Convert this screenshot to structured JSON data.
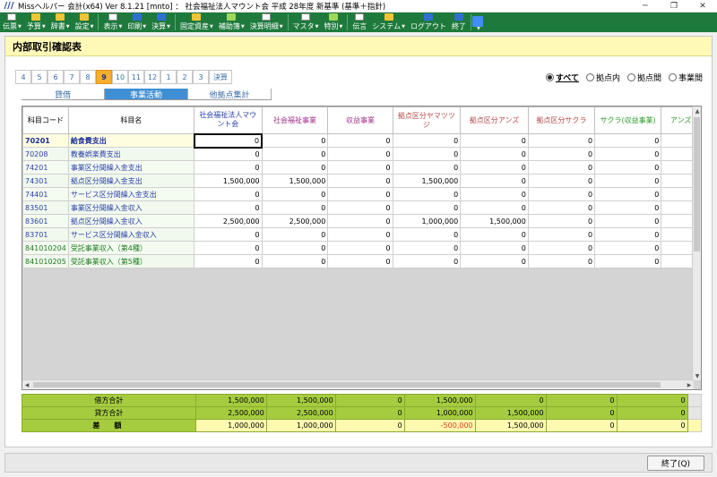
{
  "window": {
    "title": "Missヘルパー 会計(x64)   Ver 8.1.21 [mnto]  ：  社会福祉法人マウント会 平成 28年度 新基準 (基準＋指針)",
    "controls": [
      "─",
      "❐",
      "✕"
    ]
  },
  "toolbar": [
    {
      "label": "伝票",
      "icon": "slip-icon",
      "has_arrow": true
    },
    {
      "label": "予算",
      "icon": "budget-icon",
      "has_arrow": true
    },
    {
      "label": "辞書",
      "icon": "dictionary-icon",
      "has_arrow": true
    },
    {
      "label": "設定",
      "icon": "settings-icon",
      "has_arrow": true
    },
    {
      "label": "表示",
      "icon": "display-icon",
      "has_arrow": true
    },
    {
      "label": "印刷",
      "icon": "print-icon",
      "has_arrow": true
    },
    {
      "label": "決算",
      "icon": "closing-icon",
      "has_arrow": true
    },
    {
      "label": "固定資産",
      "icon": "fixed-asset-icon",
      "has_arrow": true
    },
    {
      "label": "補助簿",
      "icon": "subledger-icon",
      "has_arrow": true
    },
    {
      "label": "決算明細",
      "icon": "closing-detail-icon",
      "has_arrow": true
    },
    {
      "label": "マスタ",
      "icon": "master-icon",
      "has_arrow": true
    },
    {
      "label": "特別",
      "icon": "special-icon",
      "has_arrow": true
    },
    {
      "label": "伝言",
      "icon": "message-icon",
      "has_arrow": false
    },
    {
      "label": "システム",
      "icon": "system-icon",
      "has_arrow": true
    },
    {
      "label": "ログアウト",
      "icon": "logout-icon",
      "has_arrow": false
    },
    {
      "label": "終了",
      "icon": "exit-icon",
      "has_arrow": false
    },
    {
      "label": "",
      "icon": "user-icon",
      "has_arrow": true
    }
  ],
  "panel": {
    "title": "内部取引確認表"
  },
  "month_tabs": [
    "4",
    "5",
    "6",
    "7",
    "8",
    "9",
    "10",
    "11",
    "12",
    "1",
    "2",
    "3",
    "決算"
  ],
  "active_month": "9",
  "radio_options": [
    "すべて",
    "拠点内",
    "拠点間",
    "事業間"
  ],
  "selected_radio": "すべて",
  "sub_tabs": [
    "貸借",
    "事業活動",
    "他拠点集計"
  ],
  "active_sub_tab": "事業活動",
  "grid": {
    "columns": [
      {
        "label": "科目コード",
        "color": "#000000"
      },
      {
        "label": "科目名",
        "color": "#000000"
      },
      {
        "label": "社会福祉法人マウント会",
        "color": "#2b3fa8"
      },
      {
        "label": "社会福祉事業",
        "color": "#a0308a"
      },
      {
        "label": "収益事業",
        "color": "#a0308a"
      },
      {
        "label": "拠点区分ヤマツツジ",
        "color": "#b84a4a"
      },
      {
        "label": "拠点区分アンズ",
        "color": "#b84a4a"
      },
      {
        "label": "拠点区分サクラ",
        "color": "#b84a4a"
      },
      {
        "label": "サクラ(収益事業)",
        "color": "#2e9a2e"
      },
      {
        "label": "アンズ",
        "color": "#2e9a2e"
      }
    ],
    "rows": [
      {
        "code": "70201",
        "name": "給食費支出",
        "values": [
          "0",
          "0",
          "0",
          "0",
          "0",
          "0",
          "0",
          "0"
        ],
        "selected": true
      },
      {
        "code": "70208",
        "name": "教養娯楽費支出",
        "values": [
          "0",
          "0",
          "0",
          "0",
          "0",
          "0",
          "0",
          "0"
        ]
      },
      {
        "code": "74201",
        "name": "事業区分間繰入金支出",
        "values": [
          "0",
          "0",
          "0",
          "0",
          "0",
          "0",
          "0",
          "0"
        ]
      },
      {
        "code": "74301",
        "name": "拠点区分間繰入金支出",
        "values": [
          "1,500,000",
          "1,500,000",
          "0",
          "1,500,000",
          "0",
          "0",
          "0",
          "0"
        ]
      },
      {
        "code": "74401",
        "name": "サービス区分間繰入金支出",
        "values": [
          "0",
          "0",
          "0",
          "0",
          "0",
          "0",
          "0",
          "0"
        ]
      },
      {
        "code": "83501",
        "name": "事業区分間繰入金収入",
        "values": [
          "0",
          "0",
          "0",
          "0",
          "0",
          "0",
          "0",
          "0"
        ]
      },
      {
        "code": "83601",
        "name": "拠点区分間繰入金収入",
        "values": [
          "2,500,000",
          "2,500,000",
          "0",
          "1,000,000",
          "1,500,000",
          "0",
          "0",
          "0"
        ]
      },
      {
        "code": "83701",
        "name": "サービス区分間繰入金収入",
        "values": [
          "0",
          "0",
          "0",
          "0",
          "0",
          "0",
          "0",
          "0"
        ]
      },
      {
        "code": "841010204",
        "name": "受託事業収入（第4種）",
        "values": [
          "0",
          "0",
          "0",
          "0",
          "0",
          "0",
          "0",
          "0"
        ],
        "green": true
      },
      {
        "code": "841010205",
        "name": "受託事業収入（第5種）",
        "values": [
          "0",
          "0",
          "0",
          "0",
          "0",
          "0",
          "0",
          "0"
        ],
        "green": true
      }
    ]
  },
  "totals": [
    {
      "label": "借方合計",
      "values": [
        "1,500,000",
        "1,500,000",
        "0",
        "1,500,000",
        "0",
        "0",
        "0"
      ]
    },
    {
      "label": "貸方合計",
      "values": [
        "2,500,000",
        "2,500,000",
        "0",
        "1,000,000",
        "1,500,000",
        "0",
        "0"
      ]
    },
    {
      "label": "差　額",
      "values": [
        "1,000,000",
        "1,000,000",
        "0",
        "-500,000",
        "1,500,000",
        "0",
        "0"
      ]
    }
  ],
  "status": {
    "close_button": "終了(Q)"
  }
}
